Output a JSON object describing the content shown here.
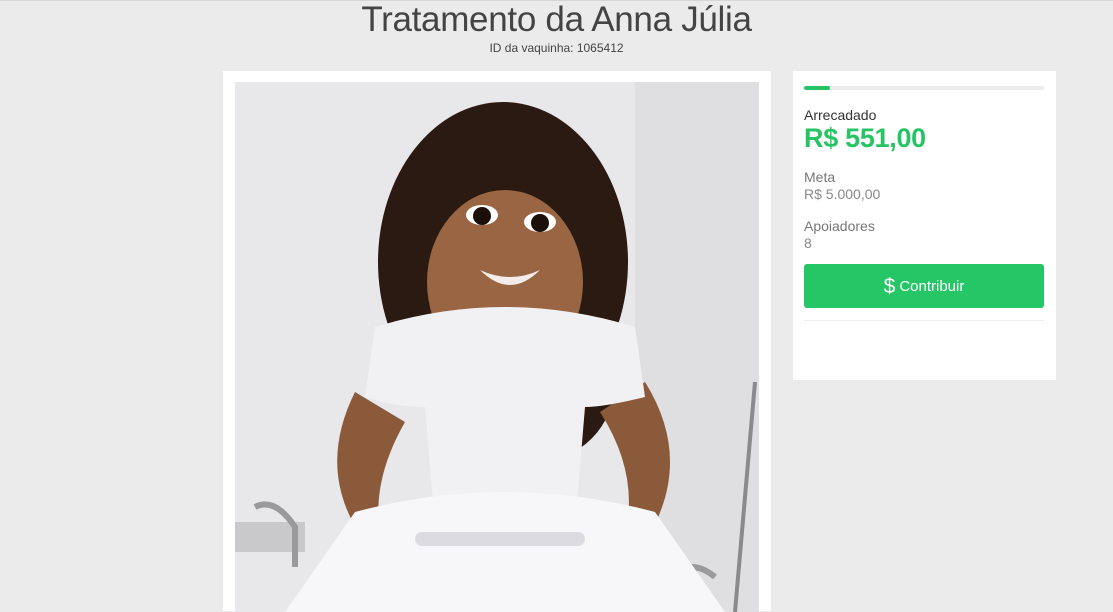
{
  "page": {
    "title": "Tratamento da Anna Júlia",
    "campaign_id": "ID da vaquinha: 1065412"
  },
  "summary": {
    "raised_label": "Arrecadado",
    "raised_value": "R$ 551,00",
    "goal_label": "Meta",
    "goal_value": "R$ 5.000,00",
    "supporters_label": "Apoiadores",
    "supporters_value": "8",
    "progress_fraction": 0.11,
    "contribute_label": "Contribuir",
    "contribute_icon": "dollar-icon"
  },
  "colors": {
    "accent": "#27c466",
    "background": "#ebebeb"
  }
}
